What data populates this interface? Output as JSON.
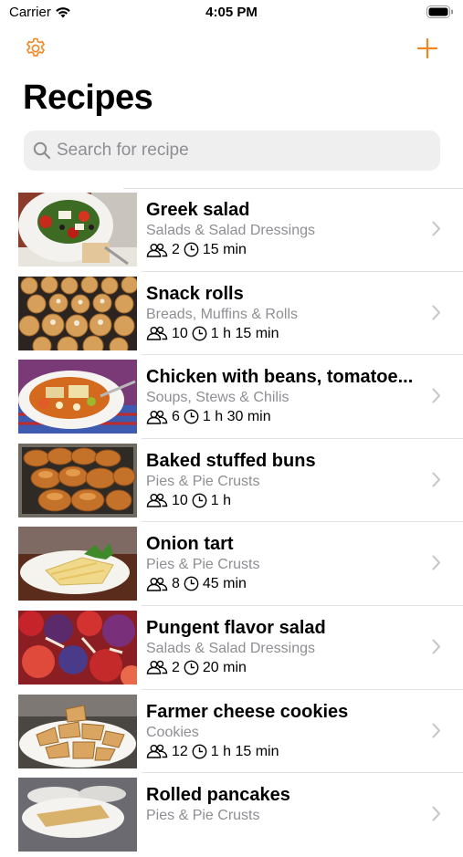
{
  "status": {
    "carrier": "Carrier",
    "time": "4:05 PM"
  },
  "nav": {
    "left_icon": "gear-icon",
    "right_icon": "plus-icon",
    "accent": "#f0861f"
  },
  "header": {
    "title": "Recipes"
  },
  "search": {
    "placeholder": "Search for recipe",
    "value": ""
  },
  "recipes": [
    {
      "name": "Greek salad",
      "category": "Salads & Salad Dressings",
      "servings": "2",
      "time": "15 min"
    },
    {
      "name": "Snack rolls",
      "category": "Breads, Muffins & Rolls",
      "servings": "10",
      "time": "1 h 15 min"
    },
    {
      "name": "Chicken with beans, tomatoe...",
      "category": "Soups, Stews & Chilis",
      "servings": "6",
      "time": "1 h 30 min"
    },
    {
      "name": "Baked stuffed buns",
      "category": "Pies & Pie Crusts",
      "servings": "10",
      "time": "1 h"
    },
    {
      "name": "Onion tart",
      "category": "Pies & Pie Crusts",
      "servings": "8",
      "time": "45 min"
    },
    {
      "name": "Pungent flavor salad",
      "category": "Salads & Salad Dressings",
      "servings": "2",
      "time": "20 min"
    },
    {
      "name": "Farmer cheese cookies",
      "category": "Cookies",
      "servings": "12",
      "time": "1 h 15 min"
    },
    {
      "name": "Rolled pancakes",
      "category": "Pies & Pie Crusts",
      "servings": "",
      "time": ""
    }
  ]
}
